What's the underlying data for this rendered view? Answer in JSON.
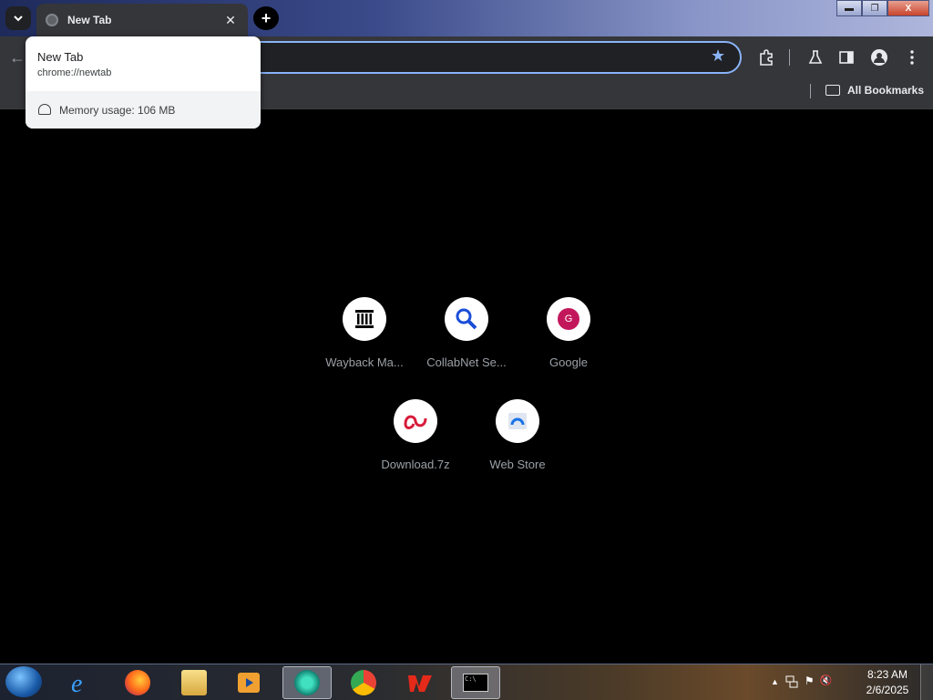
{
  "browser": {
    "tab": {
      "title": "New Tab",
      "close_glyph": "✕"
    },
    "new_tab_glyph": "+",
    "window_controls": {
      "minimize": "▬",
      "restore": "❐",
      "close": "X"
    }
  },
  "toolbar": {
    "back_glyph": "←",
    "icons": [
      "star-icon",
      "extensions-icon",
      "labs-icon",
      "side-panel-icon",
      "profile-icon",
      "menu-icon"
    ]
  },
  "bookmarks_bar": {
    "all_bookmarks_label": "All Bookmarks"
  },
  "hover_card": {
    "title": "New Tab",
    "url": "chrome://newtab",
    "memory": "Memory usage: 106 MB"
  },
  "shortcuts": [
    {
      "label": "Wayback Ma...",
      "icon": "wayback-icon"
    },
    {
      "label": "CollabNet Se...",
      "icon": "search-icon"
    },
    {
      "label": "Google",
      "icon": "google-g-icon",
      "badge": "G"
    },
    {
      "label": "Download.7z",
      "icon": "download-icon"
    },
    {
      "label": "Web Store",
      "icon": "web-store-icon"
    }
  ],
  "taskbar": {
    "apps": [
      "internet-explorer-icon",
      "firefox-icon",
      "file-explorer-icon",
      "media-player-icon",
      "chrome-canary-icon",
      "chrome-icon",
      "office-icon",
      "cmd-icon"
    ],
    "tray_glyphs": {
      "arrow": "▲",
      "flag": "⚑",
      "volume": "🔇"
    },
    "time": "8:23 AM",
    "date": "2/6/2025"
  },
  "colors": {
    "accent": "#8ab4f8",
    "page_bg": "#000000",
    "toolbar_bg": "#35363a"
  }
}
